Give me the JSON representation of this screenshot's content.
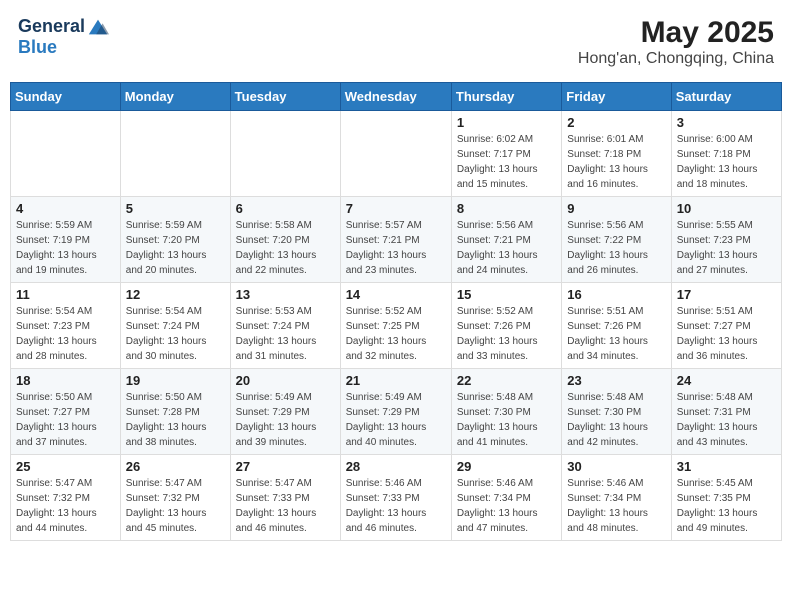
{
  "header": {
    "logo_line1": "General",
    "logo_line2": "Blue",
    "month_year": "May 2025",
    "location": "Hong'an, Chongqing, China"
  },
  "days_of_week": [
    "Sunday",
    "Monday",
    "Tuesday",
    "Wednesday",
    "Thursday",
    "Friday",
    "Saturday"
  ],
  "weeks": [
    [
      {
        "day": "",
        "detail": ""
      },
      {
        "day": "",
        "detail": ""
      },
      {
        "day": "",
        "detail": ""
      },
      {
        "day": "",
        "detail": ""
      },
      {
        "day": "1",
        "detail": "Sunrise: 6:02 AM\nSunset: 7:17 PM\nDaylight: 13 hours\nand 15 minutes."
      },
      {
        "day": "2",
        "detail": "Sunrise: 6:01 AM\nSunset: 7:18 PM\nDaylight: 13 hours\nand 16 minutes."
      },
      {
        "day": "3",
        "detail": "Sunrise: 6:00 AM\nSunset: 7:18 PM\nDaylight: 13 hours\nand 18 minutes."
      }
    ],
    [
      {
        "day": "4",
        "detail": "Sunrise: 5:59 AM\nSunset: 7:19 PM\nDaylight: 13 hours\nand 19 minutes."
      },
      {
        "day": "5",
        "detail": "Sunrise: 5:59 AM\nSunset: 7:20 PM\nDaylight: 13 hours\nand 20 minutes."
      },
      {
        "day": "6",
        "detail": "Sunrise: 5:58 AM\nSunset: 7:20 PM\nDaylight: 13 hours\nand 22 minutes."
      },
      {
        "day": "7",
        "detail": "Sunrise: 5:57 AM\nSunset: 7:21 PM\nDaylight: 13 hours\nand 23 minutes."
      },
      {
        "day": "8",
        "detail": "Sunrise: 5:56 AM\nSunset: 7:21 PM\nDaylight: 13 hours\nand 24 minutes."
      },
      {
        "day": "9",
        "detail": "Sunrise: 5:56 AM\nSunset: 7:22 PM\nDaylight: 13 hours\nand 26 minutes."
      },
      {
        "day": "10",
        "detail": "Sunrise: 5:55 AM\nSunset: 7:23 PM\nDaylight: 13 hours\nand 27 minutes."
      }
    ],
    [
      {
        "day": "11",
        "detail": "Sunrise: 5:54 AM\nSunset: 7:23 PM\nDaylight: 13 hours\nand 28 minutes."
      },
      {
        "day": "12",
        "detail": "Sunrise: 5:54 AM\nSunset: 7:24 PM\nDaylight: 13 hours\nand 30 minutes."
      },
      {
        "day": "13",
        "detail": "Sunrise: 5:53 AM\nSunset: 7:24 PM\nDaylight: 13 hours\nand 31 minutes."
      },
      {
        "day": "14",
        "detail": "Sunrise: 5:52 AM\nSunset: 7:25 PM\nDaylight: 13 hours\nand 32 minutes."
      },
      {
        "day": "15",
        "detail": "Sunrise: 5:52 AM\nSunset: 7:26 PM\nDaylight: 13 hours\nand 33 minutes."
      },
      {
        "day": "16",
        "detail": "Sunrise: 5:51 AM\nSunset: 7:26 PM\nDaylight: 13 hours\nand 34 minutes."
      },
      {
        "day": "17",
        "detail": "Sunrise: 5:51 AM\nSunset: 7:27 PM\nDaylight: 13 hours\nand 36 minutes."
      }
    ],
    [
      {
        "day": "18",
        "detail": "Sunrise: 5:50 AM\nSunset: 7:27 PM\nDaylight: 13 hours\nand 37 minutes."
      },
      {
        "day": "19",
        "detail": "Sunrise: 5:50 AM\nSunset: 7:28 PM\nDaylight: 13 hours\nand 38 minutes."
      },
      {
        "day": "20",
        "detail": "Sunrise: 5:49 AM\nSunset: 7:29 PM\nDaylight: 13 hours\nand 39 minutes."
      },
      {
        "day": "21",
        "detail": "Sunrise: 5:49 AM\nSunset: 7:29 PM\nDaylight: 13 hours\nand 40 minutes."
      },
      {
        "day": "22",
        "detail": "Sunrise: 5:48 AM\nSunset: 7:30 PM\nDaylight: 13 hours\nand 41 minutes."
      },
      {
        "day": "23",
        "detail": "Sunrise: 5:48 AM\nSunset: 7:30 PM\nDaylight: 13 hours\nand 42 minutes."
      },
      {
        "day": "24",
        "detail": "Sunrise: 5:48 AM\nSunset: 7:31 PM\nDaylight: 13 hours\nand 43 minutes."
      }
    ],
    [
      {
        "day": "25",
        "detail": "Sunrise: 5:47 AM\nSunset: 7:32 PM\nDaylight: 13 hours\nand 44 minutes."
      },
      {
        "day": "26",
        "detail": "Sunrise: 5:47 AM\nSunset: 7:32 PM\nDaylight: 13 hours\nand 45 minutes."
      },
      {
        "day": "27",
        "detail": "Sunrise: 5:47 AM\nSunset: 7:33 PM\nDaylight: 13 hours\nand 46 minutes."
      },
      {
        "day": "28",
        "detail": "Sunrise: 5:46 AM\nSunset: 7:33 PM\nDaylight: 13 hours\nand 46 minutes."
      },
      {
        "day": "29",
        "detail": "Sunrise: 5:46 AM\nSunset: 7:34 PM\nDaylight: 13 hours\nand 47 minutes."
      },
      {
        "day": "30",
        "detail": "Sunrise: 5:46 AM\nSunset: 7:34 PM\nDaylight: 13 hours\nand 48 minutes."
      },
      {
        "day": "31",
        "detail": "Sunrise: 5:45 AM\nSunset: 7:35 PM\nDaylight: 13 hours\nand 49 minutes."
      }
    ]
  ]
}
